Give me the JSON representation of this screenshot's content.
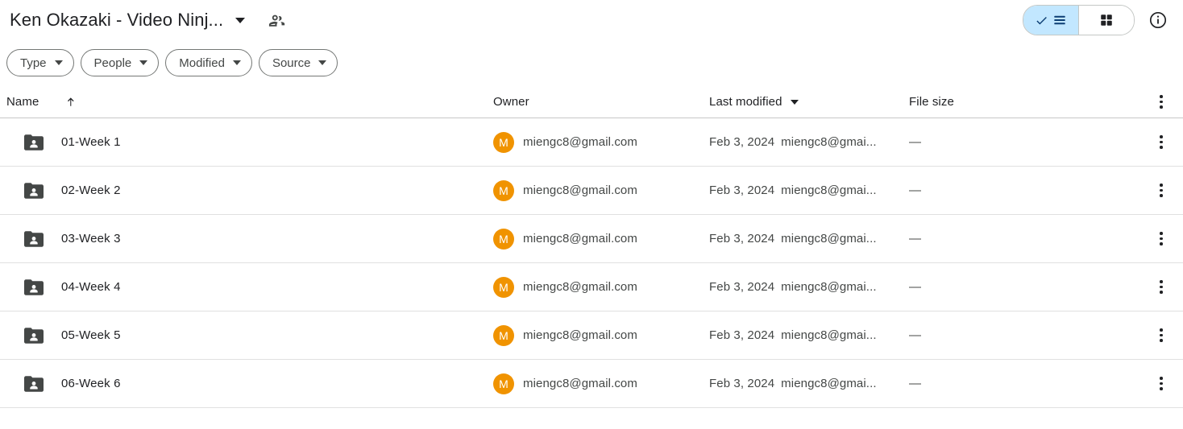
{
  "header": {
    "title": "Ken Okazaki - Video Ninj...",
    "title_caret_icon": "chevron-down-icon",
    "shared_icon": "people-icon",
    "view_toggle": {
      "list_label": "List view",
      "list_icon": "check-list-icon",
      "grid_label": "Grid view",
      "grid_icon": "grid-icon",
      "selected": "list",
      "selected_bg": "#c2e7ff"
    },
    "info_icon": "info-circle-icon",
    "info_label": "View details"
  },
  "filters": [
    {
      "label": "Type",
      "icon": "chevron-down-icon"
    },
    {
      "label": "People",
      "icon": "chevron-down-icon"
    },
    {
      "label": "Modified",
      "icon": "chevron-down-icon"
    },
    {
      "label": "Source",
      "icon": "chevron-down-icon"
    }
  ],
  "table": {
    "columns": {
      "name": "Name",
      "name_sort_icon": "arrow-up-icon",
      "owner": "Owner",
      "modified": "Last modified",
      "modified_caret_icon": "chevron-down-icon",
      "size": "File size",
      "overflow_icon": "more-vert-icon"
    },
    "rows": [
      {
        "icon": "shared-folder-icon",
        "name": "01-Week 1",
        "owner_initial": "M",
        "owner": "miengc8@gmail.com",
        "modified_date": "Feb 3, 2024",
        "modified_by": "miengc8@gmai...",
        "size": "—",
        "overflow_icon": "more-vert-icon"
      },
      {
        "icon": "shared-folder-icon",
        "name": "02-Week 2",
        "owner_initial": "M",
        "owner": "miengc8@gmail.com",
        "modified_date": "Feb 3, 2024",
        "modified_by": "miengc8@gmai...",
        "size": "—",
        "overflow_icon": "more-vert-icon"
      },
      {
        "icon": "shared-folder-icon",
        "name": "03-Week 3",
        "owner_initial": "M",
        "owner": "miengc8@gmail.com",
        "modified_date": "Feb 3, 2024",
        "modified_by": "miengc8@gmai...",
        "size": "—",
        "overflow_icon": "more-vert-icon"
      },
      {
        "icon": "shared-folder-icon",
        "name": "04-Week 4",
        "owner_initial": "M",
        "owner": "miengc8@gmail.com",
        "modified_date": "Feb 3, 2024",
        "modified_by": "miengc8@gmai...",
        "size": "—",
        "overflow_icon": "more-vert-icon"
      },
      {
        "icon": "shared-folder-icon",
        "name": "05-Week 5",
        "owner_initial": "M",
        "owner": "miengc8@gmail.com",
        "modified_date": "Feb 3, 2024",
        "modified_by": "miengc8@gmai...",
        "size": "—",
        "overflow_icon": "more-vert-icon"
      },
      {
        "icon": "shared-folder-icon",
        "name": "06-Week 6",
        "owner_initial": "M",
        "owner": "miengc8@gmail.com",
        "modified_date": "Feb 3, 2024",
        "modified_by": "miengc8@gmai...",
        "size": "—",
        "overflow_icon": "more-vert-icon"
      }
    ]
  },
  "colors": {
    "accent_selected": "#c2e7ff",
    "accent_icon": "#0b57d0",
    "avatar": "#f09300",
    "folder": "#444746",
    "text_primary": "#202124",
    "text_secondary": "#444746",
    "divider": "#e0e0e0"
  }
}
